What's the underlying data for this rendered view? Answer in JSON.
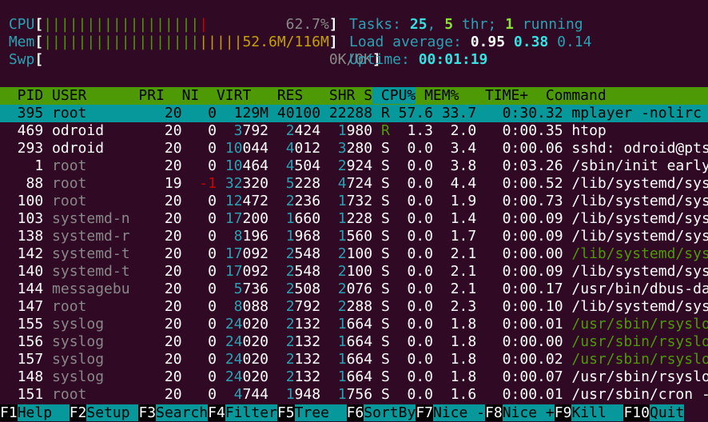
{
  "meters": {
    "cpu": {
      "label": "CPU",
      "green_bar": "||||||||||||||||||",
      "red_bar": "|",
      "pad": "         ",
      "value": "62.7%"
    },
    "mem": {
      "label": "Mem",
      "green_bar": "||||||||||||||||||",
      "yellow_bar": "|||||",
      "value": "52.6M/116M"
    },
    "swp": {
      "label": "Swp",
      "pad": "                                 ",
      "value": "0K/0K"
    }
  },
  "stats": {
    "tasks_label": "Tasks: ",
    "tasks": "25",
    "sep1": ", ",
    "threads": "5",
    "thr_label": " thr; ",
    "running": "1",
    "running_label": " running",
    "load_label": "Load average: ",
    "load1": "0.95",
    "load5": "0.38",
    "load15": "0.14",
    "uptime_label": "Uptime: ",
    "uptime": "00:01:19"
  },
  "columns": {
    "pid": "  PID",
    "user": " USER",
    "pri": "      PRI",
    "ni": "  NI",
    "virt": "  VIRT",
    "res": "   RES",
    "shr": "   SHR",
    "s": " S",
    "cpu": " CPU%",
    "mem": " MEM%",
    "time": "   TIME+",
    "command": "  Command"
  },
  "processes": [
    {
      "pid": "395",
      "user": "root",
      "pri": "20",
      "ni": "0",
      "virt": "129M",
      "res": "40100",
      "shr": "22288",
      "s": "R",
      "cpu": "57.6",
      "mem": "33.7",
      "time": "0:30.32",
      "cmd": "mplayer -nolirc -"
    },
    {
      "pid": "469",
      "user": "odroid",
      "pri": "20",
      "ni": "0",
      "virt": "3792",
      "res": "2424",
      "shr": "1980",
      "s": "R",
      "cpu": "1.3",
      "mem": "2.0",
      "time": "0:00.35",
      "cmd": "htop"
    },
    {
      "pid": "293",
      "user": "odroid",
      "pri": "20",
      "ni": "0",
      "virt": "10044",
      "res": "4012",
      "shr": "3280",
      "s": "S",
      "cpu": "0.0",
      "mem": "3.4",
      "time": "0:00.06",
      "cmd": "sshd: odroid@pts/"
    },
    {
      "pid": "1",
      "user": "root",
      "pri": "20",
      "ni": "0",
      "virt": "10464",
      "res": "4504",
      "shr": "2924",
      "s": "S",
      "cpu": "0.0",
      "mem": "3.8",
      "time": "0:03.26",
      "cmd": "/sbin/init earlyp"
    },
    {
      "pid": "88",
      "user": "root",
      "pri": "19",
      "ni": "-1",
      "virt": "32320",
      "res": "5228",
      "shr": "4724",
      "s": "S",
      "cpu": "0.0",
      "mem": "4.4",
      "time": "0:00.52",
      "cmd": "/lib/systemd/syst"
    },
    {
      "pid": "100",
      "user": "root",
      "pri": "20",
      "ni": "0",
      "virt": "12472",
      "res": "2236",
      "shr": "1732",
      "s": "S",
      "cpu": "0.0",
      "mem": "1.9",
      "time": "0:00.73",
      "cmd": "/lib/systemd/syst"
    },
    {
      "pid": "103",
      "user": "systemd-n",
      "pri": "20",
      "ni": "0",
      "virt": "17200",
      "res": "1660",
      "shr": "1228",
      "s": "S",
      "cpu": "0.0",
      "mem": "1.4",
      "time": "0:00.09",
      "cmd": "/lib/systemd/syst"
    },
    {
      "pid": "138",
      "user": "systemd-r",
      "pri": "20",
      "ni": "0",
      "virt": "8196",
      "res": "1968",
      "shr": "1560",
      "s": "S",
      "cpu": "0.0",
      "mem": "1.7",
      "time": "0:00.09",
      "cmd": "/lib/systemd/syst"
    },
    {
      "pid": "142",
      "user": "systemd-t",
      "pri": "20",
      "ni": "0",
      "virt": "17092",
      "res": "2548",
      "shr": "2100",
      "s": "S",
      "cpu": "0.0",
      "mem": "2.1",
      "time": "0:00.00",
      "cmd": "/lib/systemd/syst"
    },
    {
      "pid": "140",
      "user": "systemd-t",
      "pri": "20",
      "ni": "0",
      "virt": "17092",
      "res": "2548",
      "shr": "2100",
      "s": "S",
      "cpu": "0.0",
      "mem": "2.1",
      "time": "0:00.09",
      "cmd": "/lib/systemd/syst"
    },
    {
      "pid": "144",
      "user": "messagebu",
      "pri": "20",
      "ni": "0",
      "virt": "5736",
      "res": "2508",
      "shr": "2076",
      "s": "S",
      "cpu": "0.0",
      "mem": "2.1",
      "time": "0:00.17",
      "cmd": "/usr/bin/dbus-dae"
    },
    {
      "pid": "147",
      "user": "root",
      "pri": "20",
      "ni": "0",
      "virt": "8088",
      "res": "2792",
      "shr": "2288",
      "s": "S",
      "cpu": "0.0",
      "mem": "2.3",
      "time": "0:00.10",
      "cmd": "/lib/systemd/syst"
    },
    {
      "pid": "155",
      "user": "syslog",
      "pri": "20",
      "ni": "0",
      "virt": "24020",
      "res": "2132",
      "shr": "1664",
      "s": "S",
      "cpu": "0.0",
      "mem": "1.8",
      "time": "0:00.01",
      "cmd": "/usr/sbin/rsyslog"
    },
    {
      "pid": "156",
      "user": "syslog",
      "pri": "20",
      "ni": "0",
      "virt": "24020",
      "res": "2132",
      "shr": "1664",
      "s": "S",
      "cpu": "0.0",
      "mem": "1.8",
      "time": "0:00.00",
      "cmd": "/usr/sbin/rsyslog"
    },
    {
      "pid": "157",
      "user": "syslog",
      "pri": "20",
      "ni": "0",
      "virt": "24020",
      "res": "2132",
      "shr": "1664",
      "s": "S",
      "cpu": "0.0",
      "mem": "1.8",
      "time": "0:00.02",
      "cmd": "/usr/sbin/rsyslog"
    },
    {
      "pid": "148",
      "user": "syslog",
      "pri": "20",
      "ni": "0",
      "virt": "24020",
      "res": "2132",
      "shr": "1664",
      "s": "S",
      "cpu": "0.0",
      "mem": "1.8",
      "time": "0:00.07",
      "cmd": "/usr/sbin/rsyslog"
    },
    {
      "pid": "151",
      "user": "root",
      "pri": "20",
      "ni": "0",
      "virt": "4744",
      "res": "1948",
      "shr": "1756",
      "s": "S",
      "cpu": "0.0",
      "mem": "1.6",
      "time": "0:00.01",
      "cmd": "/usr/sbin/cron -f"
    }
  ],
  "footer": [
    {
      "key": "F1",
      "label": "Help  "
    },
    {
      "key": "F2",
      "label": "Setup "
    },
    {
      "key": "F3",
      "label": "Search"
    },
    {
      "key": "F4",
      "label": "Filter"
    },
    {
      "key": "F5",
      "label": "Tree  "
    },
    {
      "key": "F6",
      "label": "SortBy"
    },
    {
      "key": "F7",
      "label": "Nice -"
    },
    {
      "key": "F8",
      "label": "Nice +"
    },
    {
      "key": "F9",
      "label": "Kill  "
    },
    {
      "key": "F10",
      "label": "Quit"
    }
  ],
  "colors": {
    "background": "#300a24",
    "header_bg": "#4e9a06",
    "selected_bg": "#06989a",
    "cyan": "#2aa1b3",
    "green": "#4e9a06",
    "red": "#cc0000",
    "yellow": "#c4a000"
  }
}
